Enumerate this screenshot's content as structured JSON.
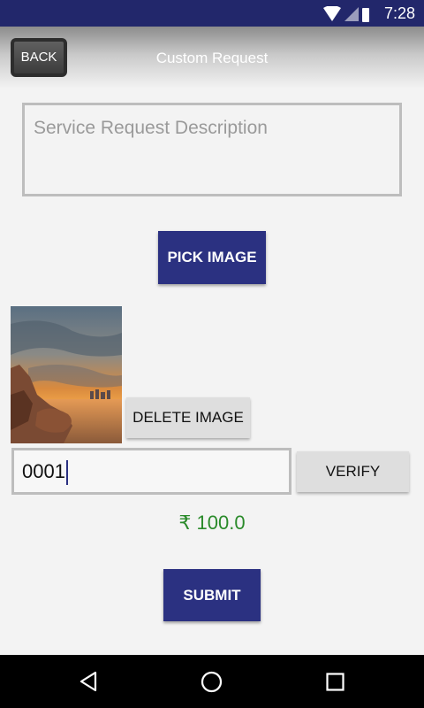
{
  "status_bar": {
    "time": "7:28",
    "icons": [
      "wifi-icon",
      "signal-icon",
      "battery-charging-icon"
    ]
  },
  "header": {
    "back_label": "BACK",
    "title": "Custom Request"
  },
  "form": {
    "description_placeholder": "Service Request Description",
    "pick_image_label": "PICK IMAGE",
    "delete_image_label": "DELETE IMAGE",
    "code_value": "0001",
    "verify_label": "VERIFY",
    "price": "₹ 100.0",
    "submit_label": "SUBMIT"
  },
  "nav_bar": {
    "icons": [
      "back-nav-icon",
      "home-nav-icon",
      "recents-nav-icon"
    ]
  },
  "colors": {
    "primary": "#2b3181",
    "status_bar": "#22276b",
    "price": "#2a8a2a"
  }
}
